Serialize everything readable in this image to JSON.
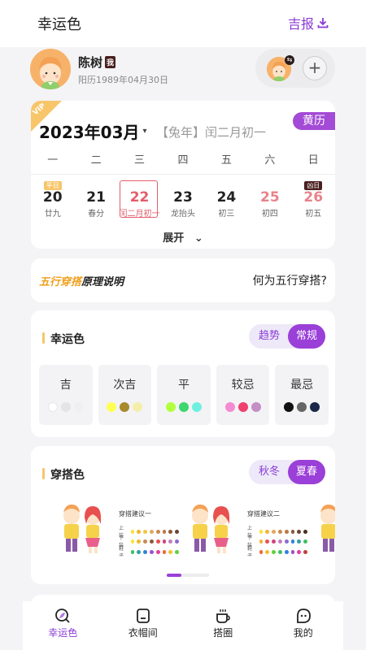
{
  "header": {
    "title": "幸运色",
    "report_label": "吉报"
  },
  "profile": {
    "name": "陈树",
    "badge": "我",
    "birth": "阳历1989年04月30日",
    "swap_glyph": "⇆",
    "add_glyph": "+"
  },
  "calendar": {
    "vip": "VIP",
    "huangli": "黄历",
    "year_month": "2023年03月",
    "caret": "▾",
    "lunar_header": "【兔年】闰二月初一",
    "weekdays": [
      "一",
      "二",
      "三",
      "四",
      "五",
      "六",
      "日"
    ],
    "days": [
      {
        "num": "20",
        "sub": "廿九",
        "tag": "平日"
      },
      {
        "num": "21",
        "sub": "春分",
        "tag": ""
      },
      {
        "num": "22",
        "sub": "闰二月初一",
        "tag": "",
        "selected": true
      },
      {
        "num": "23",
        "sub": "龙抬头",
        "tag": ""
      },
      {
        "num": "24",
        "sub": "初三",
        "tag": ""
      },
      {
        "num": "25",
        "sub": "初四",
        "tag": "",
        "weekend": true
      },
      {
        "num": "26",
        "sub": "初五",
        "tag": "凶日",
        "weekend": true
      }
    ],
    "expand_label": "展开",
    "expand_caret": "⌄"
  },
  "principle": {
    "left_highlight": "五行穿搭",
    "left_rest": "原理说明",
    "right": "何为五行穿搭?"
  },
  "lucky": {
    "title": "幸运色",
    "seg_off": "趋势",
    "seg_on": "常规",
    "tiles": [
      {
        "label": "吉",
        "colors": [
          "#ffffff",
          "#e4e4e4",
          "#efefef"
        ]
      },
      {
        "label": "次吉",
        "colors": [
          "#ffff55",
          "#a88a2c",
          "#f5eeaa"
        ]
      },
      {
        "label": "平",
        "colors": [
          "#b3ff3c",
          "#3ed66e",
          "#6ff0de"
        ]
      },
      {
        "label": "较忌",
        "colors": [
          "#f48bd0",
          "#f0406e",
          "#c48fc4"
        ]
      },
      {
        "label": "最忌",
        "colors": [
          "#111111",
          "#666666",
          "#1a2748"
        ]
      }
    ]
  },
  "outfit": {
    "title": "穿搭色",
    "seg_off": "秋冬",
    "seg_on": "夏春",
    "looks": [
      {
        "title": "穿搭建议一",
        "rows": [
          {
            "label": "上装",
            "colors": [
              "#f7e33c",
              "#f0b630",
              "#f0c840",
              "#e0a860",
              "#c88a50",
              "#b97a48",
              "#8a5a3a",
              "#6a4430"
            ]
          },
          {
            "label": "下装",
            "colors": [
              "#f7e33c",
              "#f0b630",
              "#c88a50",
              "#8a5a3a",
              "#e85050",
              "#d44080",
              "#c080c0",
              "#8a6ad0"
            ]
          },
          {
            "label": "鞋子",
            "colors": [
              "#40c060",
              "#30a0a0",
              "#3080e0",
              "#9a50d0",
              "#e0409a",
              "#f06a3a",
              "#f0c030",
              "#60d040"
            ]
          }
        ]
      },
      {
        "title": "穿搭建议二",
        "rows": [
          {
            "label": "上装",
            "colors": [
              "#f7e33c",
              "#f0b630",
              "#e0a860",
              "#c88a50",
              "#b97a48",
              "#8a5a3a",
              "#6a4430",
              "#4a3020"
            ]
          },
          {
            "label": "下装",
            "colors": [
              "#f0b630",
              "#e85050",
              "#d44080",
              "#c080c0",
              "#8a6ad0",
              "#3080e0",
              "#30a0a0",
              "#40c060"
            ]
          },
          {
            "label": "鞋子",
            "colors": [
              "#f06a3a",
              "#f0c030",
              "#60d040",
              "#40c060",
              "#3080e0",
              "#9a50d0",
              "#e0409a",
              "#c04040"
            ]
          }
        ]
      }
    ]
  },
  "tabs": [
    {
      "label": "幸运色",
      "icon": "lucky-color-icon",
      "active": true
    },
    {
      "label": "衣帽间",
      "icon": "wardrobe-icon"
    },
    {
      "label": "搭圈",
      "icon": "cup-icon"
    },
    {
      "label": "我的",
      "icon": "profile-chat-icon"
    }
  ],
  "colors": {
    "accent": "#9a3fd8",
    "gold": "#f7c56a",
    "alert": "#e35d6a"
  }
}
